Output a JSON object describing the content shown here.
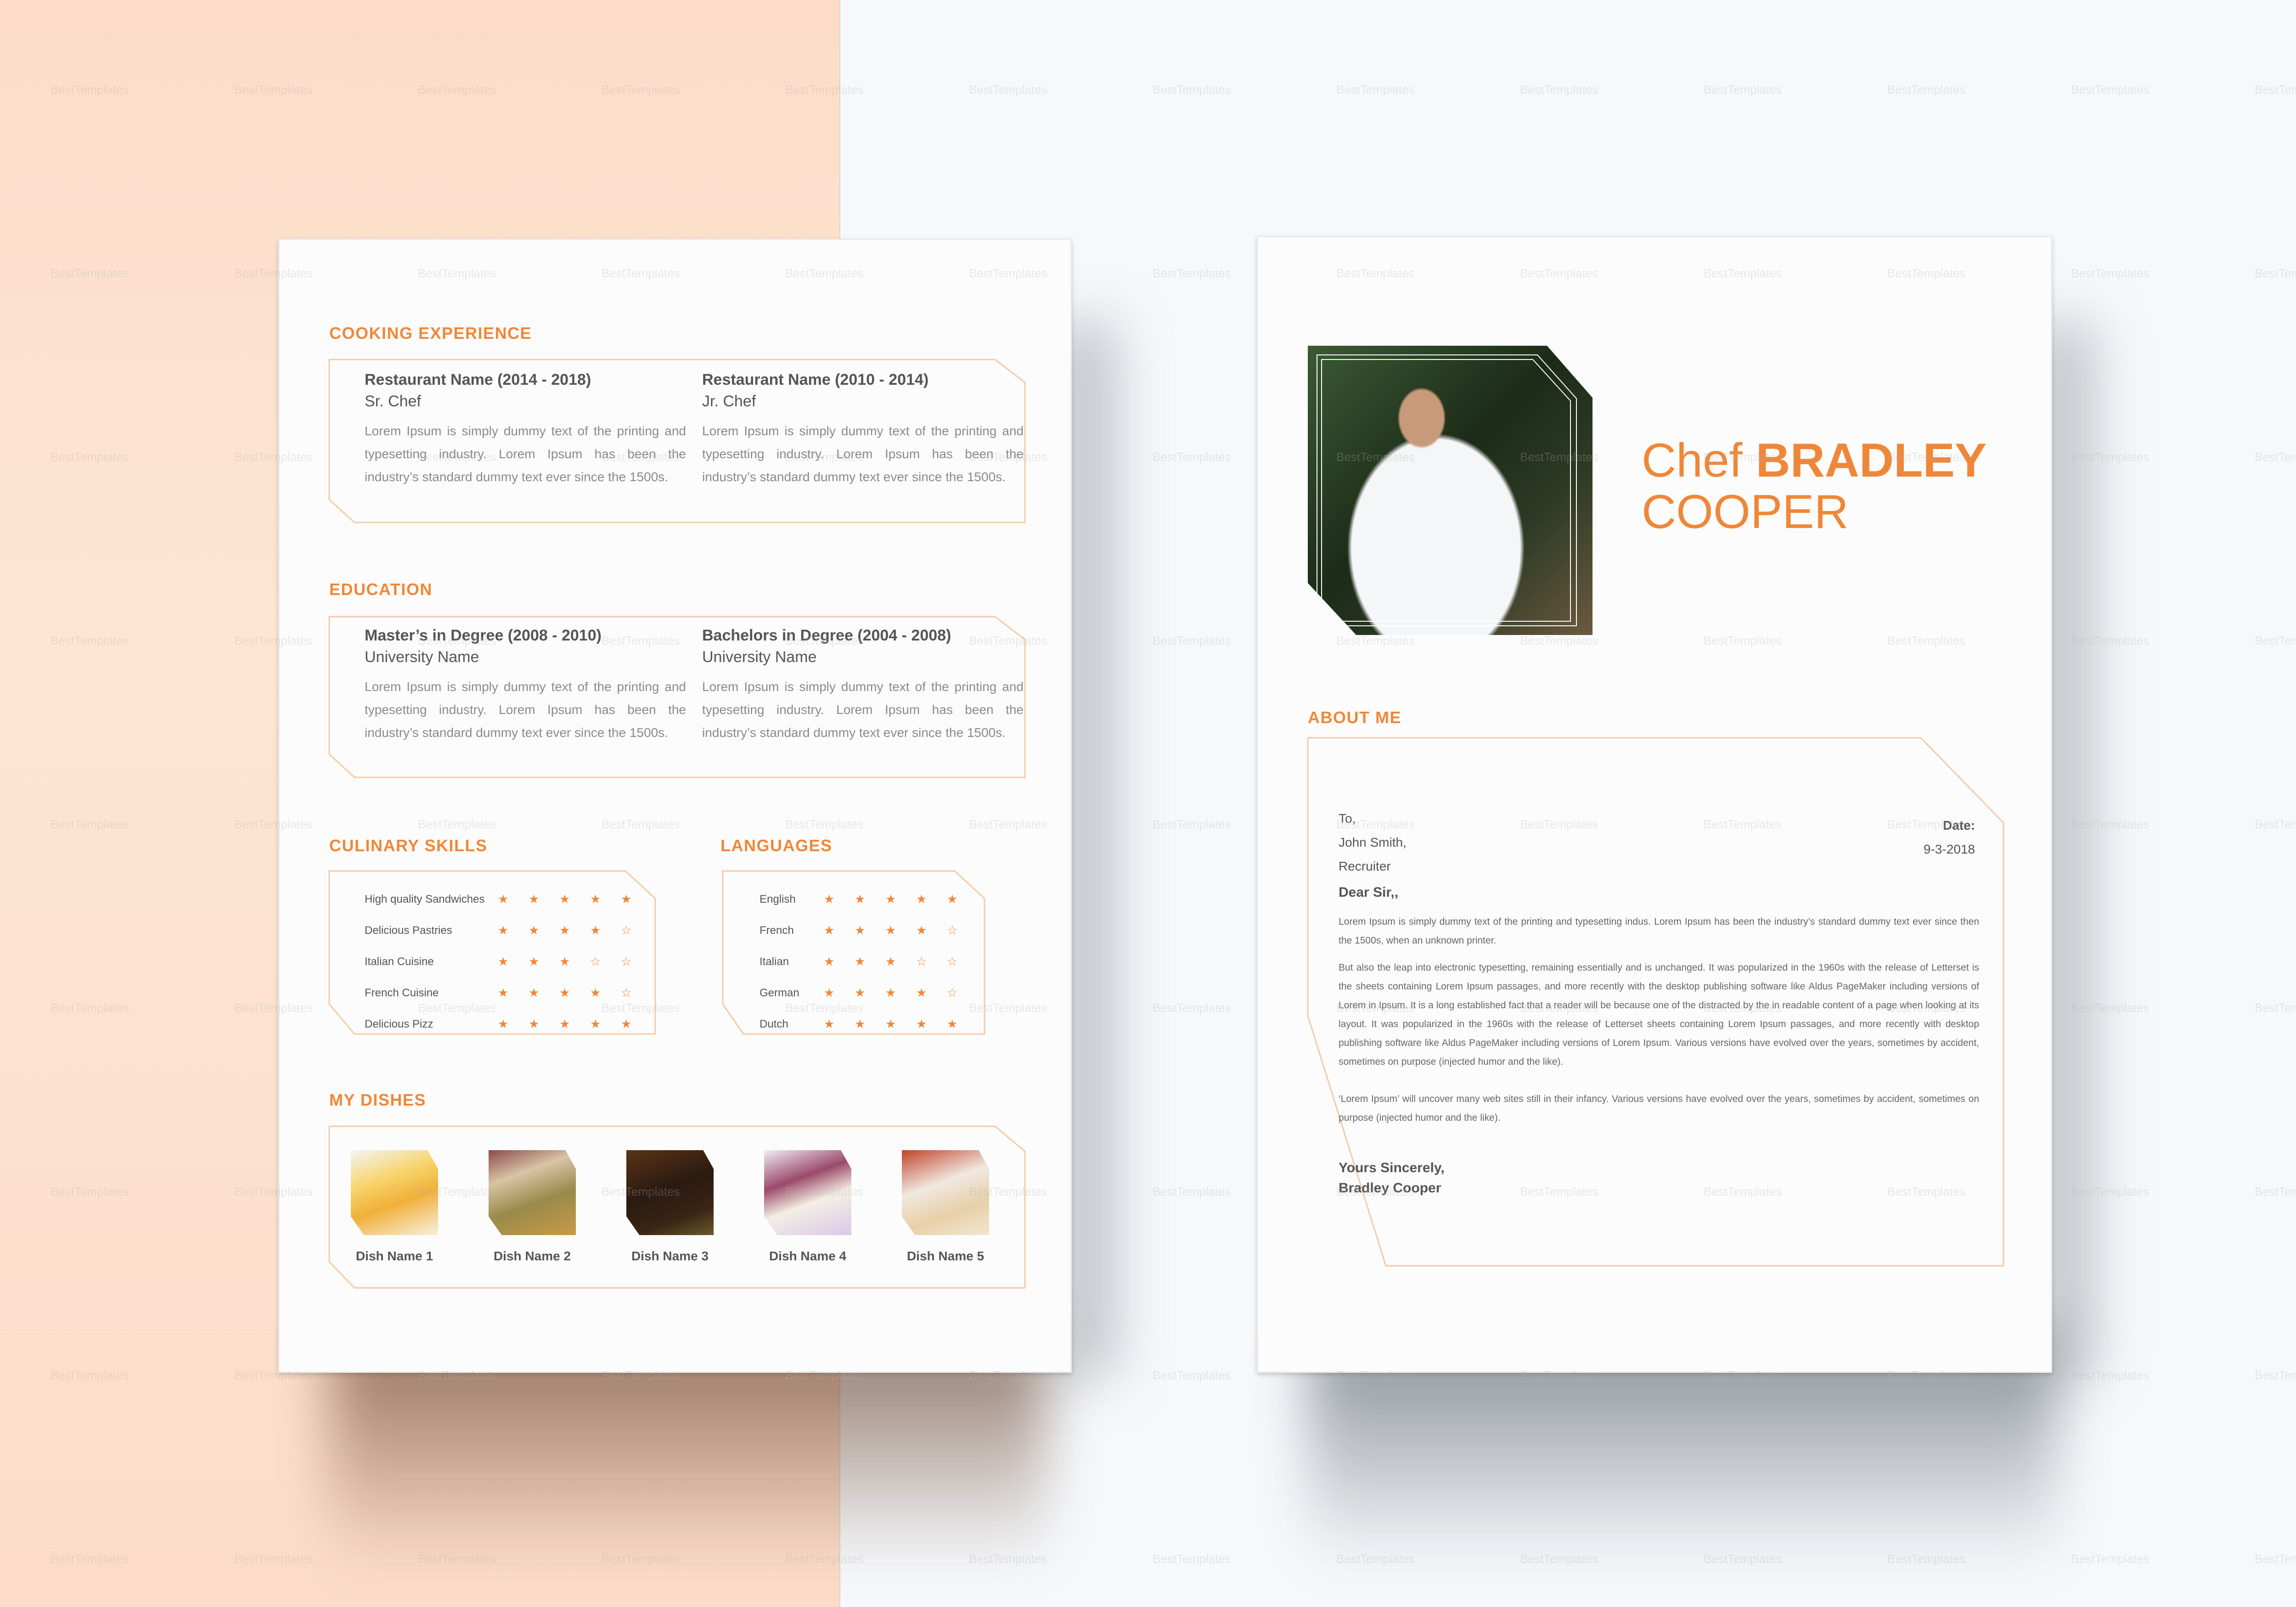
{
  "left_page": {
    "cooking_experience": {
      "title": "COOKING EXPERIENCE",
      "entries": [
        {
          "title": "Restaurant Name (2014 - 2018)",
          "subtitle": "Sr. Chef",
          "text": "Lorem Ipsum is simply dummy text of the printing and typesetting industry. Lorem Ipsum has been the industry’s standard dummy text ever since the 1500s."
        },
        {
          "title": "Restaurant Name (2010 - 2014)",
          "subtitle": "Jr. Chef",
          "text": "Lorem Ipsum is simply dummy text of the printing and typesetting industry. Lorem Ipsum has been the industry’s standard dummy text ever since the 1500s."
        }
      ]
    },
    "education": {
      "title": "EDUCATION",
      "entries": [
        {
          "title": "Master’s in Degree (2008 - 2010)",
          "subtitle": "University Name",
          "text": "Lorem Ipsum is simply dummy text of the printing and typesetting industry. Lorem Ipsum has been the industry’s standard dummy text ever since the 1500s."
        },
        {
          "title": "Bachelors in Degree (2004 - 2008)",
          "subtitle": "University Name",
          "text": "Lorem Ipsum is simply dummy text of the printing and typesetting industry. Lorem Ipsum has been the industry’s standard dummy text ever since the 1500s."
        }
      ]
    },
    "culinary_skills": {
      "title": "CULINARY SKILLS",
      "max_rating": 5,
      "items": [
        {
          "label": "High quality Sandwiches",
          "rating": 5
        },
        {
          "label": "Delicious Pastries",
          "rating": 4
        },
        {
          "label": "Italian Cuisine",
          "rating": 3
        },
        {
          "label": "French Cuisine",
          "rating": 4
        },
        {
          "label": "Delicious Pizz",
          "rating": 5
        }
      ]
    },
    "languages": {
      "title": "LANGUAGES",
      "max_rating": 5,
      "items": [
        {
          "label": "English",
          "rating": 5
        },
        {
          "label": "French",
          "rating": 4
        },
        {
          "label": "Italian",
          "rating": 3
        },
        {
          "label": "German",
          "rating": 4
        },
        {
          "label": "Dutch",
          "rating": 5
        }
      ]
    },
    "my_dishes": {
      "title": "MY DISHES",
      "items": [
        {
          "name": "Dish Name 1",
          "image": "cake-photo"
        },
        {
          "name": "Dish Name 2",
          "image": "roasted-potatoes-photo"
        },
        {
          "name": "Dish Name 3",
          "image": "steak-photo"
        },
        {
          "name": "Dish Name 4",
          "image": "breakfast-eggs-photo"
        },
        {
          "name": "Dish Name 5",
          "image": "crepes-photo"
        }
      ]
    }
  },
  "right_page": {
    "name": {
      "prefix": "Chef",
      "first": "BRADLEY",
      "last": "COOPER"
    },
    "photo": "chef-portrait-photo",
    "about_me": {
      "title": "ABOUT ME",
      "to_label": "To,",
      "recipient_name": "John Smith,",
      "recipient_title": "Recruiter",
      "date_label": "Date:",
      "date_value": "9-3-2018",
      "salutation": "Dear Sir,,",
      "paragraphs": [
        "Lorem Ipsum is simply dummy text of the printing and typesetting indus. Lorem Ipsum has been the industry’s standard dummy text ever since then the 1500s, when an unknown printer.",
        "But also the leap into electronic typesetting, remaining essentially and is unchanged. It was popularized in the 1960s with the release of Letterset is the sheets containing Lorem Ipsum passages, and more recently with the desktop publishing software like Aldus PageMaker including versions of Lorem in Ipsum. It is a long established fact that a reader will be because one of the distracted by the in readable content of a page when looking at its layout. It was popularized in the 1960s with the release of Letterset sheets containing Lorem Ipsum passages, and more recently with desktop publishing software like Aldus PageMaker including versions of Lorem Ipsum. Various versions have evolved over the years, sometimes by accident, sometimes on purpose (injected humor and the like).",
        "‘Lorem Ipsum’ will uncover many web sites still in their infancy. Various versions have evolved over the years, sometimes by accident, sometimes on purpose (injected humor and the like)."
      ],
      "closing": "Yours Sincerely,",
      "signature": "Bradley Cooper"
    }
  },
  "watermark": "BestTemplates",
  "colors": {
    "accent": "#ef8739",
    "frame": "#f7c9a6",
    "text": "#555555",
    "peach_bg": "#fcdcc8",
    "right_bg": "#f6f9fc"
  }
}
